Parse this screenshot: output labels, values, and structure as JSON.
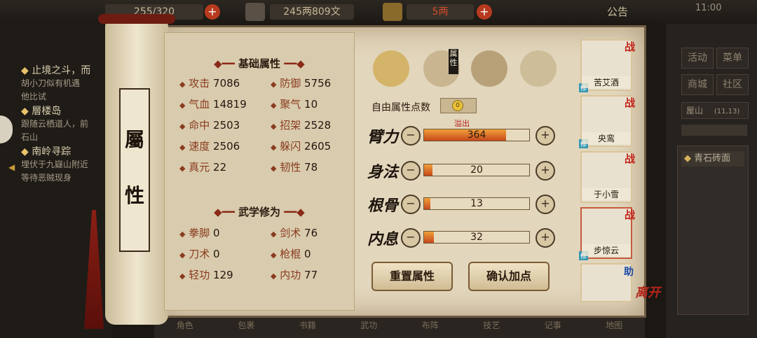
{
  "topbar": {
    "storage": "255/320",
    "money": "245两809文",
    "gold": "5两",
    "notice": "公告",
    "time": "11:00"
  },
  "quests": [
    {
      "title": "止境之斗，而",
      "desc": "胡小刀似有机遇\n他比试"
    },
    {
      "title": "層楼岛",
      "desc": "跟随云栖道人，前\n石山"
    },
    {
      "title": "南岭寻踪",
      "desc": "埋伏于九嶷山附近\n等待恶贼现身"
    }
  ],
  "scroll": {
    "title": "屬性"
  },
  "base_section": {
    "title": "基础属性",
    "stats": [
      {
        "label": "攻击",
        "value": "7086"
      },
      {
        "label": "防御",
        "value": "5756"
      },
      {
        "label": "气血",
        "value": "14819"
      },
      {
        "label": "聚气",
        "value": "10"
      },
      {
        "label": "命中",
        "value": "2503"
      },
      {
        "label": "招架",
        "value": "2528"
      },
      {
        "label": "速度",
        "value": "2506"
      },
      {
        "label": "躲闪",
        "value": "2605"
      },
      {
        "label": "真元",
        "value": "22"
      },
      {
        "label": "韧性",
        "value": "78"
      }
    ]
  },
  "martial_section": {
    "title": "武学修为",
    "stats": [
      {
        "label": "拳脚",
        "value": "0"
      },
      {
        "label": "剑术",
        "value": "76"
      },
      {
        "label": "刀术",
        "value": "0"
      },
      {
        "label": "枪棍",
        "value": "0"
      },
      {
        "label": "轻功",
        "value": "129"
      },
      {
        "label": "内功",
        "value": "77"
      }
    ]
  },
  "tabs": {
    "attr_label": "属性"
  },
  "points": {
    "label": "自由属性点数",
    "value": "0"
  },
  "attributes": [
    {
      "name": "臂力",
      "value": "364",
      "fill": 0.78,
      "overflow": "溢出"
    },
    {
      "name": "身法",
      "value": "20",
      "fill": 0.08
    },
    {
      "name": "根骨",
      "value": "13",
      "fill": 0.06
    },
    {
      "name": "内息",
      "value": "32",
      "fill": 0.09
    }
  ],
  "buttons": {
    "reset": "重置属性",
    "confirm": "确认加点"
  },
  "party": [
    {
      "name": "苦艾酒",
      "tag": "战"
    },
    {
      "name": "央鸾",
      "tag": "战"
    },
    {
      "name": "于小雪",
      "tag": "战"
    },
    {
      "name": "步惊云",
      "tag": "战"
    },
    {
      "name": "",
      "tag": "助"
    }
  ],
  "leave": "离开",
  "right_menu": {
    "row1": [
      "活动",
      "菜单"
    ],
    "row2": [
      "商城",
      "社区"
    ],
    "location": "屋山",
    "coords": "(11,13)",
    "item": "青石砖面"
  },
  "bottom_nav": [
    "角色",
    "包裹",
    "书籍",
    "武功",
    "布阵",
    "技艺",
    "记事",
    "地图"
  ]
}
